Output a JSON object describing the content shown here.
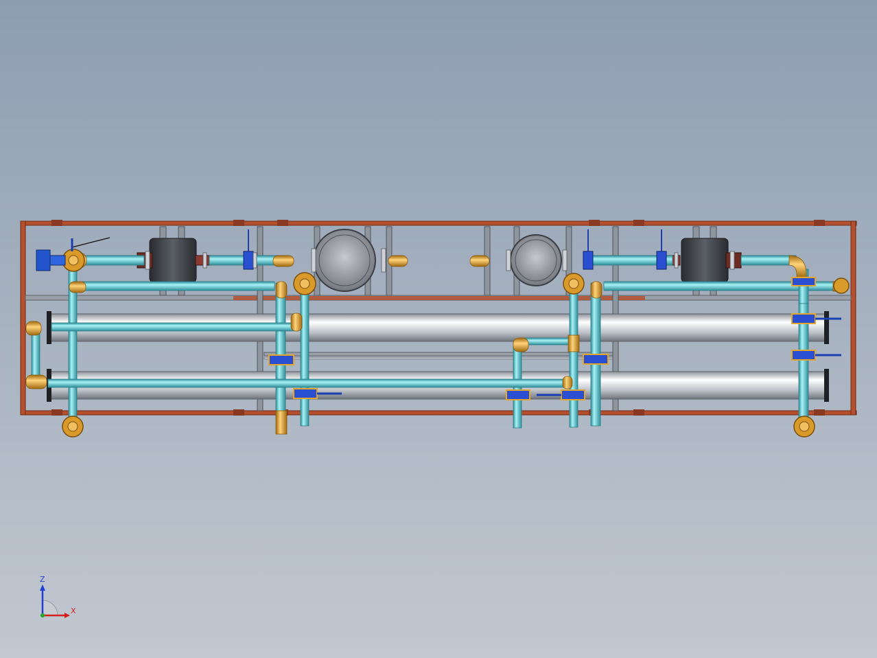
{
  "window": {
    "background_top": "#8d9db1",
    "background_bottom": "#c2c8d0"
  },
  "model": {
    "colors": {
      "frame": "#b4502e",
      "frame_dark": "#7a2c18",
      "beam": "#9aa0a8",
      "post": "#8e959d",
      "pipe": "#5ec9d3",
      "pipe_dark": "#2f8e99",
      "fitting": "#e5a52a",
      "fitting_dark": "#a06a10",
      "valve": "#2b4fd1",
      "vessel": "#a9adb3",
      "motor": "#3c3f44",
      "membrane": "#d8dce2"
    }
  },
  "triad": {
    "z_label": "Z",
    "x_label": "X",
    "z_color": "#1f3fd6",
    "x_color": "#d42020",
    "y_color": "#1faa2a"
  }
}
